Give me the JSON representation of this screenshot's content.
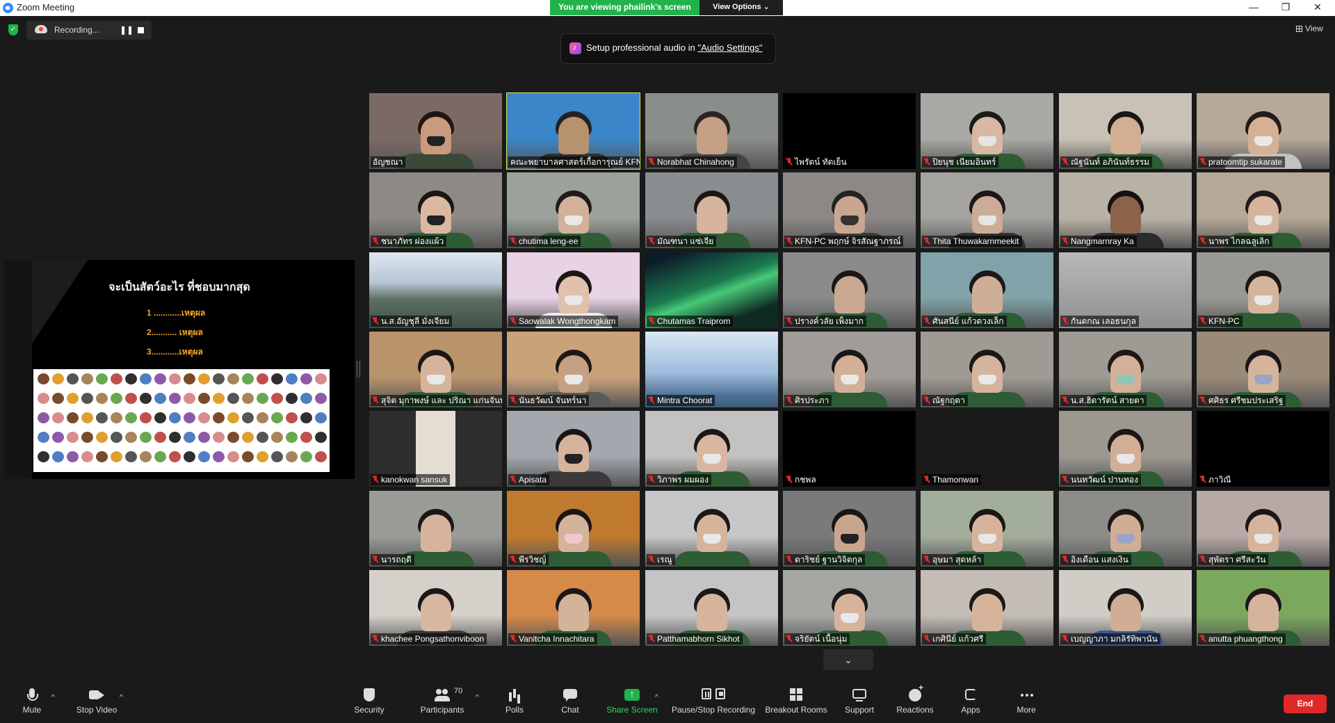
{
  "window": {
    "title": "Zoom Meeting",
    "viewing_banner": "You are viewing phailink's screen",
    "view_options": "View Options ⌄",
    "minimize": "—",
    "restore": "❐",
    "close": "✕"
  },
  "recording": {
    "label": "Recording...",
    "pause_glyph": "❚❚"
  },
  "view_button": "View",
  "audio_tip": {
    "prefix": "Setup professional audio in ",
    "link": "\"Audio Settings\""
  },
  "shared_screen": {
    "title": "จะเป็นสัตว์อะไร ที่ชอบมากสุด",
    "lines": [
      "1 ............เหตุผล",
      "2........... เหตุผล",
      "3............เหตุผล"
    ]
  },
  "participants": [
    {
      "name": "อัญชณา",
      "muted": false,
      "bg": "#7b6a63",
      "skin": "#c99a7e",
      "hair": "#1d1614",
      "mask": "#222",
      "shirt": "#3b4a38",
      "cam": true
    },
    {
      "name": "คณะพยาบาลศาสตร์เกื้อการุณย์ KFN",
      "muted": false,
      "bg": "#3a86c8",
      "skin": "#b7926f",
      "hair": "#222",
      "mask": "",
      "shirt": "#2f2f2f",
      "cam": true,
      "active": true
    },
    {
      "name": "Norabhat Chinahong",
      "muted": true,
      "bg": "#8a8e8a",
      "skin": "#c6a085",
      "hair": "#2a2322",
      "mask": "",
      "shirt": "#444",
      "cam": true
    },
    {
      "name": "ไพรัตน์ ทัดเย็น",
      "muted": true,
      "bg": "#000",
      "cam": false
    },
    {
      "name": "ปิยนุช เนียมอินทร์",
      "muted": true,
      "bg": "#a9aaa5",
      "skin": "#d8b8a2",
      "hair": "#1e1a1a",
      "mask": "#e5e5e5",
      "shirt": "#2e5c35",
      "cam": true
    },
    {
      "name": "ณัฐนันท์ อภินันท์ธรรม",
      "muted": true,
      "bg": "#c8c2b6",
      "skin": "#d2ae93",
      "hair": "#1a1616",
      "mask": "",
      "shirt": "#2e5c35",
      "cam": true
    },
    {
      "name": "pratoomtip sukarate",
      "muted": true,
      "bg": "#b7a99a",
      "skin": "#d4b095",
      "hair": "#221c1a",
      "mask": "#e8e8e8",
      "shirt": "#c2c2c2",
      "cam": true
    },
    {
      "name": "ชนาภัทร ผ่องแผ้ว",
      "muted": true,
      "bg": "#8d8a86",
      "skin": "#dbb8a0",
      "hair": "#1b1514",
      "mask": "#222",
      "shirt": "#2e5c35",
      "cam": true
    },
    {
      "name": "chutima leng-ee",
      "muted": true,
      "bg": "#9aa29a",
      "skin": "#d2b09a",
      "hair": "#201a19",
      "mask": "#e8e8e8",
      "shirt": "#2e5c35",
      "cam": true
    },
    {
      "name": "มัณฑนา แซ่เจีย",
      "muted": true,
      "bg": "#8a8d90",
      "skin": "#d5b39d",
      "hair": "#1b1716",
      "mask": "",
      "shirt": "#2e5c35",
      "cam": true
    },
    {
      "name": "KFN-PC พฤกษ์ จิรสัณฐาภรณ์",
      "muted": true,
      "bg": "#8b8886",
      "skin": "#caa690",
      "hair": "#222",
      "mask": "#333",
      "shirt": "#3c3c3c",
      "cam": true
    },
    {
      "name": "Thita Thuwakarnmeekit",
      "muted": true,
      "bg": "#a5a39f",
      "skin": "#ccac96",
      "hair": "#1c1818",
      "mask": "#e5e5e5",
      "shirt": "#2f2f2f",
      "cam": true
    },
    {
      "name": "Nangmarnray Ka",
      "muted": true,
      "bg": "#b8b2a6",
      "skin": "#8d624a",
      "hair": "#151111",
      "mask": "",
      "shirt": "#2b2b2b",
      "cam": true
    },
    {
      "name": "นาพร ไกลฉลูเลิก",
      "muted": true,
      "bg": "#b5a896",
      "skin": "#d5b39c",
      "hair": "#201a19",
      "mask": "#e8e8e8",
      "shirt": "#2e5c35",
      "cam": true
    },
    {
      "name": "น.ส.อัญชุลี มั่งเจียม",
      "muted": true,
      "bg": "#8a98a8",
      "cam": false,
      "scene": "mountain"
    },
    {
      "name": "Saowalak Wongthongkam",
      "muted": true,
      "bg": "#e7d2e6",
      "skin": "#e0c1ab",
      "hair": "#1c1717",
      "mask": "#e8e8e8",
      "shirt": "#ececec",
      "cam": true
    },
    {
      "name": "Chutamas Traiprom",
      "muted": true,
      "bg": "#13332b",
      "cam": false,
      "scene": "aurora"
    },
    {
      "name": "ปรางค์วลัย เพ็งมาก",
      "muted": true,
      "bg": "#8a8a8a",
      "skin": "#c8a890",
      "hair": "#1b1616",
      "mask": "",
      "shirt": "#2e5c35",
      "cam": true
    },
    {
      "name": "ศันสนีย์ แก้วดวงเล็ก",
      "muted": true,
      "bg": "#7fa3a8",
      "skin": "#cfae98",
      "hair": "#1c1717",
      "mask": "",
      "shirt": "#2e5c35",
      "cam": true
    },
    {
      "name": "กันตกณ เลอธนกุล",
      "muted": true,
      "bg": "#a6a6a6",
      "cam": false,
      "scene": "room"
    },
    {
      "name": "KFN-PC",
      "muted": true,
      "bg": "#9a9892",
      "skin": "#d6b49c",
      "hair": "#1b1616",
      "mask": "#e8e8e8",
      "shirt": "#2e5c35",
      "cam": true
    },
    {
      "name": "สุจิต มุกาพงษ์ และ ปริณา แก่นจันทร์",
      "muted": true,
      "bg": "#b9936a",
      "skin": "#d6b49c",
      "hair": "#1c1717",
      "mask": "#e8e8e8",
      "shirt": "#2e5c35",
      "cam": true
    },
    {
      "name": "นันธวัฒน์ จันทร์นา",
      "muted": true,
      "bg": "#caa27a",
      "skin": "#c6a083",
      "hair": "#1e1918",
      "mask": "#e8e8e8",
      "shirt": "#5a5a5a",
      "cam": true
    },
    {
      "name": "Mintra Choorat",
      "muted": true,
      "bg": "#8aa6c6",
      "cam": false,
      "scene": "building"
    },
    {
      "name": "ศิรประภา",
      "muted": true,
      "bg": "#a09c98",
      "skin": "#d3af97",
      "hair": "#1c1717",
      "mask": "#e8e8e8",
      "shirt": "#2e5c35",
      "cam": true
    },
    {
      "name": "ณัฐกฤตา",
      "muted": true,
      "bg": "#9f9b94",
      "skin": "#d6b49c",
      "hair": "#1c1717",
      "mask": "#e8e8e8",
      "shirt": "#2e5c35",
      "cam": true
    },
    {
      "name": "น.ส.ฮิดารัตน์ สายตา",
      "muted": true,
      "bg": "#9e9a94",
      "skin": "#d3b098",
      "hair": "#1d1818",
      "mask": "#8fc6b8",
      "shirt": "#2e5c35",
      "cam": true
    },
    {
      "name": "ศศิธร ศรีชมประเสริฐ",
      "muted": true,
      "bg": "#9a8a78",
      "skin": "#d6b49c",
      "hair": "#1b1616",
      "mask": "#9aa3c8",
      "shirt": "#2e5c35",
      "cam": true
    },
    {
      "name": "kanokwan sansuk",
      "muted": true,
      "bg": "#3b3b3b",
      "cam": false,
      "scene": "door"
    },
    {
      "name": "Apisata",
      "muted": true,
      "bg": "#a3a8ae",
      "skin": "#d6b49c",
      "hair": "#1b1616",
      "mask": "#222",
      "shirt": "#3a3a3a",
      "cam": true
    },
    {
      "name": "วิภาพร ผมผอง",
      "muted": true,
      "bg": "#c3c2c0",
      "skin": "#d8b7a0",
      "hair": "#1c1717",
      "mask": "#e8e8e8",
      "shirt": "#2e5c35",
      "cam": true
    },
    {
      "name": "กชพล",
      "muted": true,
      "bg": "#000",
      "cam": false
    },
    {
      "name": "Thamonwan",
      "muted": true,
      "bg": "#1a1a1a",
      "cam": false
    },
    {
      "name": "นนทวัฒน์ ปานทอง",
      "muted": true,
      "bg": "#9c9890",
      "skin": "#d2ae96",
      "hair": "#1c1717",
      "mask": "#e8e8e8",
      "shirt": "#2e5c35",
      "cam": true
    },
    {
      "name": "ภาวิณี",
      "muted": true,
      "bg": "#000",
      "cam": false
    },
    {
      "name": "นารถฤดี",
      "muted": true,
      "bg": "#9a9c98",
      "skin": "#d6b49c",
      "hair": "#1c1717",
      "mask": "",
      "shirt": "#2e5c35",
      "cam": true
    },
    {
      "name": "พีรวิชญ์",
      "muted": true,
      "bg": "#c07a30",
      "skin": "#d4b39b",
      "hair": "#1b1616",
      "mask": "#f2c6cf",
      "shirt": "#2e5c35",
      "cam": true
    },
    {
      "name": "เรณู",
      "muted": true,
      "bg": "#c6c7c8",
      "skin": "#d6b49c",
      "hair": "#1c1717",
      "mask": "#e8e8e8",
      "shirt": "#2e5c35",
      "cam": true
    },
    {
      "name": "ดาริชย์ ฐานวิจิตกุล",
      "muted": true,
      "bg": "#7a7a7a",
      "skin": "#c8a68e",
      "hair": "#1b1616",
      "mask": "#222",
      "shirt": "#2e5c35",
      "cam": true
    },
    {
      "name": "อุษมา สุดหล้า",
      "muted": true,
      "bg": "#a3ad9c",
      "skin": "#d6b49c",
      "hair": "#1c1717",
      "mask": "#e8e8e8",
      "shirt": "#2e5c35",
      "cam": true
    },
    {
      "name": "อิงเดือน แสงเงิน",
      "muted": true,
      "bg": "#8d8c88",
      "skin": "#d0ad95",
      "hair": "#1c1717",
      "mask": "#9aa3c8",
      "shirt": "#2e5c35",
      "cam": true
    },
    {
      "name": "สุพัตรา ศรีสะวัน",
      "muted": true,
      "bg": "#b7a9a6",
      "skin": "#d6b49c",
      "hair": "#1c1717",
      "mask": "#e8e8e8",
      "shirt": "#2e5c35",
      "cam": true
    },
    {
      "name": "khachee Pongsathonviboon",
      "muted": true,
      "bg": "#d5d0ca",
      "skin": "#d8b7a0",
      "hair": "#1c1717",
      "mask": "",
      "shirt": "#3a3a3a",
      "cam": true
    },
    {
      "name": "Vanitcha Innachitara",
      "muted": true,
      "bg": "#d58a4a",
      "skin": "#d4b39b",
      "hair": "#1c1717",
      "mask": "",
      "shirt": "#2e5c35",
      "cam": true
    },
    {
      "name": "Patthamabhorn Sikhot",
      "muted": true,
      "bg": "#c3c4c6",
      "skin": "#d6b49c",
      "hair": "#1c1717",
      "mask": "",
      "shirt": "#2e5c35",
      "cam": true
    },
    {
      "name": "จริยัตน์ เนื้อนุ่ม",
      "muted": true,
      "bg": "#a4a7a2",
      "skin": "#d6b49c",
      "hair": "#1c1717",
      "mask": "#e8e8e8",
      "shirt": "#2e5c35",
      "cam": true
    },
    {
      "name": "เกศินีย์ แก้วศรี",
      "muted": true,
      "bg": "#c4bdb6",
      "skin": "#d6b49c",
      "hair": "#1c1717",
      "mask": "",
      "shirt": "#2e5c35",
      "cam": true
    },
    {
      "name": "เบญญาภา มกลิรัทิพานัน",
      "muted": true,
      "bg": "#d0cdc7",
      "skin": "#d0ad95",
      "hair": "#1c1717",
      "mask": "",
      "shirt": "#3a5a8c",
      "cam": true
    },
    {
      "name": "anutta phuangthong",
      "muted": true,
      "bg": "#7aa95e",
      "skin": "#d6b49c",
      "hair": "#1c1717",
      "mask": "",
      "shirt": "#2e5c35",
      "cam": true
    }
  ],
  "collapse_glyph": "⌄",
  "toolbar": {
    "mute": "Mute",
    "stop_video": "Stop Video",
    "security": "Security",
    "participants": "Participants",
    "participants_count": "70",
    "polls": "Polls",
    "chat": "Chat",
    "share_screen": "Share Screen",
    "pause_stop_recording": "Pause/Stop Recording",
    "breakout_rooms": "Breakout Rooms",
    "support": "Support",
    "reactions": "Reactions",
    "apps": "Apps",
    "more": "More",
    "end": "End",
    "caret": "^"
  },
  "colors": {
    "viewing_banner": "#22b24c",
    "share_screen_icon": "#22b24c",
    "end_button": "#e02828",
    "active_speaker_border": "#d6e95a",
    "muted_mic": "#e02828"
  }
}
